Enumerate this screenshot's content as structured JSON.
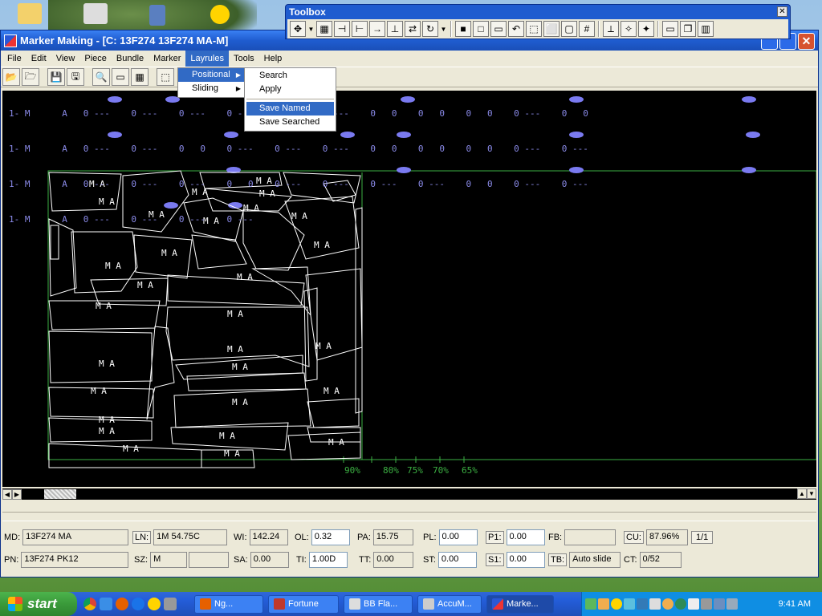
{
  "window": {
    "title": "Marker Making - [C:  13F274   13F274 MA-M]"
  },
  "toolbox": {
    "title": "Toolbox",
    "close": "✕"
  },
  "menu": {
    "items": [
      "File",
      "Edit",
      "View",
      "Piece",
      "Bundle",
      "Marker",
      "Layrules",
      "Tools",
      "Help"
    ],
    "active": "Layrules"
  },
  "layrules_menu": {
    "items": [
      "Positional",
      "Sliding"
    ],
    "active": "Positional"
  },
  "positional_submenu": {
    "items": [
      "Search",
      "Apply",
      "Save Named",
      "Save Searched"
    ],
    "active": "Save Named"
  },
  "bundle_rows": [
    "1- M      A   0 ---    0 ---    0 ---    0 ---    0 ---    0 ---    0   0    0   0    0   0    0 ---    0   0",
    "1- M      A   0 ---    0 ---    0   0    0 ---    0 ---    0 ---    0   0    0   0    0   0    0 ---    0 ---",
    "1- M      A   0 ---    0 ---    0 ---    0   0    0 ---    0 ---    0 ---    0 ---    0   0    0 ---    0 ---",
    "1- M      A   0 ---    0 ---    0 ---    0 ---"
  ],
  "piece_label": "M  A",
  "efficiency_marks": [
    "90%",
    "80%",
    "75%",
    "70%",
    "65%"
  ],
  "status": {
    "md_label": "MD:",
    "md": "13F274 MA",
    "ln_label": "LN:",
    "ln": "1M 54.75C",
    "wi_label": "WI:",
    "wi": "142.24",
    "ol_label": "OL:",
    "ol": "0.32",
    "pa_label": "PA:",
    "pa": "15.75",
    "pl_label": "PL:",
    "pl": "0.00",
    "p1_label": "P1:",
    "p1": "0.00",
    "fb_label": "FB:",
    "fb": "",
    "cu_label": "CU:",
    "cu": "87.96%",
    "page": "1/1",
    "pn_label": "PN:",
    "pn": "13F274 PK12",
    "sz_label": "SZ:",
    "sz": "M",
    "sz2": "",
    "sa_label": "SA:",
    "sa": "0.00",
    "ti_label": "TI:",
    "ti": "1.00D",
    "tt_label": "TT:",
    "tt": "0.00",
    "st_label": "ST:",
    "st": "0.00",
    "s1_label": "S1:",
    "s1": "0.00",
    "tb_label": "TB:",
    "tb": "Auto slide",
    "ct_label": "CT:",
    "ct": "0/52"
  },
  "taskbar": {
    "start": "start",
    "tasks": [
      "Ng...",
      "Fortune",
      "BB Fla...",
      "AccuM...",
      "Marke..."
    ],
    "active_task": "Marke...",
    "clock": "9:41 AM"
  },
  "colors": {
    "canvas_bg": "#000000",
    "piece_outline": "#ffffff",
    "bundle_text": "#8a8ae8",
    "marker_border": "#3cb043",
    "highlight": "#316ac5"
  }
}
